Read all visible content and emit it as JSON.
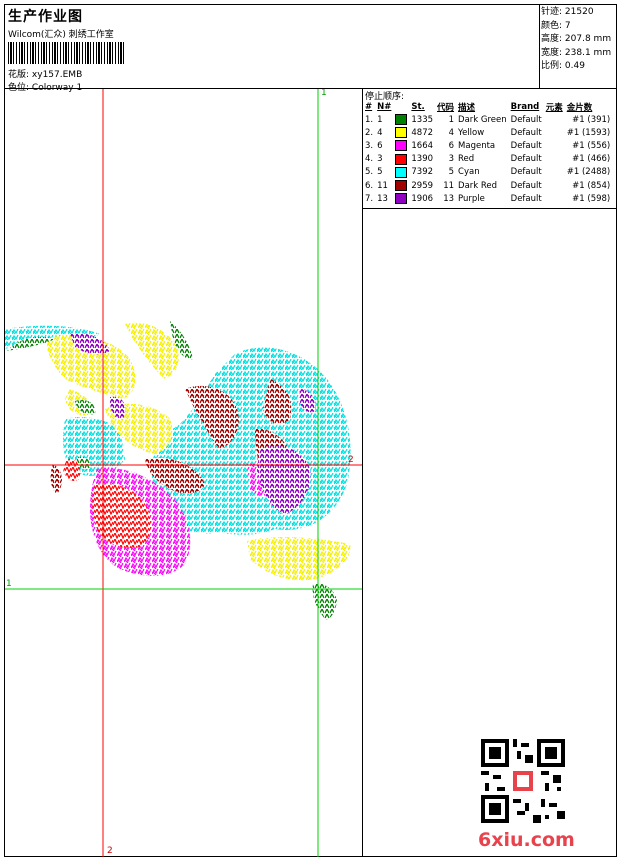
{
  "header": {
    "title": "生产作业图",
    "company": "Wilcom(汇众) 刺绣工作室",
    "design_label": "花版:",
    "design_value": "xy157.EMB",
    "colorway_label": "色位:",
    "colorway_value": "Colorway 1"
  },
  "stats": {
    "stitches_label": "针迹:",
    "stitches_value": "21520",
    "colors_label": "颜色:",
    "colors_value": "7",
    "height_label": "高度:",
    "height_value": "207.8 mm",
    "width_label": "宽度:",
    "width_value": "238.1 mm",
    "scale_label": "比例:",
    "scale_value": "0.49"
  },
  "sequence": {
    "title": "停止顺序:",
    "columns": [
      "#",
      "N#",
      "St.",
      "代码",
      "描述",
      "Brand",
      "元素",
      "金片数"
    ],
    "rows": [
      {
        "idx": "1.",
        "n": "1",
        "color": "#008000",
        "st": "1335",
        "code": "1",
        "desc": "Dark Green",
        "brand": "Default",
        "seq": "#1 (391)"
      },
      {
        "idx": "2.",
        "n": "4",
        "color": "#ffff00",
        "st": "4872",
        "code": "4",
        "desc": "Yellow",
        "brand": "Default",
        "seq": "#1 (1593)"
      },
      {
        "idx": "3.",
        "n": "6",
        "color": "#ff00ff",
        "st": "1664",
        "code": "6",
        "desc": "Magenta",
        "brand": "Default",
        "seq": "#1 (556)"
      },
      {
        "idx": "4.",
        "n": "3",
        "color": "#ff0000",
        "st": "1390",
        "code": "3",
        "desc": "Red",
        "brand": "Default",
        "seq": "#1 (466)"
      },
      {
        "idx": "5.",
        "n": "5",
        "color": "#00ffff",
        "st": "7392",
        "code": "5",
        "desc": "Cyan",
        "brand": "Default",
        "seq": "#1 (2488)"
      },
      {
        "idx": "6.",
        "n": "11",
        "color": "#a00000",
        "st": "2959",
        "code": "11",
        "desc": "Dark Red",
        "brand": "Default",
        "seq": "#1 (854)"
      },
      {
        "idx": "7.",
        "n": "13",
        "color": "#9000c0",
        "st": "1906",
        "code": "13",
        "desc": "Purple",
        "brand": "Default",
        "seq": "#1 (598)"
      }
    ]
  },
  "guides": {
    "green_1": "1",
    "red_2": "2"
  },
  "watermark": "6xiu.com"
}
